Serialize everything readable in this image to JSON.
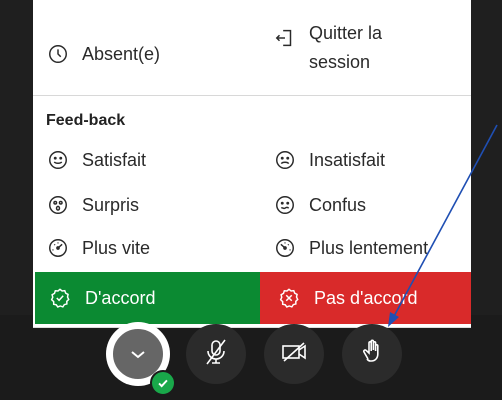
{
  "menu": {
    "absent_label": "Absent(e)",
    "quit_label_line1": "Quitter la",
    "quit_label_line2": "session",
    "feedback_title": "Feed-back",
    "items": [
      {
        "label": "Satisfait",
        "icon": "smile-icon"
      },
      {
        "label": "Insatisfait",
        "icon": "sad-face-icon"
      },
      {
        "label": "Surpris",
        "icon": "surprised-face-icon"
      },
      {
        "label": "Confus",
        "icon": "confused-face-icon"
      },
      {
        "label": "Plus vite",
        "icon": "speed-fast-icon"
      },
      {
        "label": "Plus lentement",
        "icon": "speed-slow-icon"
      }
    ],
    "agree_label": "D'accord",
    "disagree_label": "Pas d'accord",
    "agree_color": "#0b8a32",
    "disagree_color": "#d92a2a"
  },
  "controls": [
    {
      "name": "avatar-button",
      "icon": "user-avatar-icon"
    },
    {
      "name": "microphone-muted-button",
      "icon": "mic-off-icon"
    },
    {
      "name": "camera-off-button",
      "icon": "camera-off-icon"
    },
    {
      "name": "raise-hand-button",
      "icon": "hand-icon"
    }
  ],
  "annotation_color": "#1f4fb3"
}
